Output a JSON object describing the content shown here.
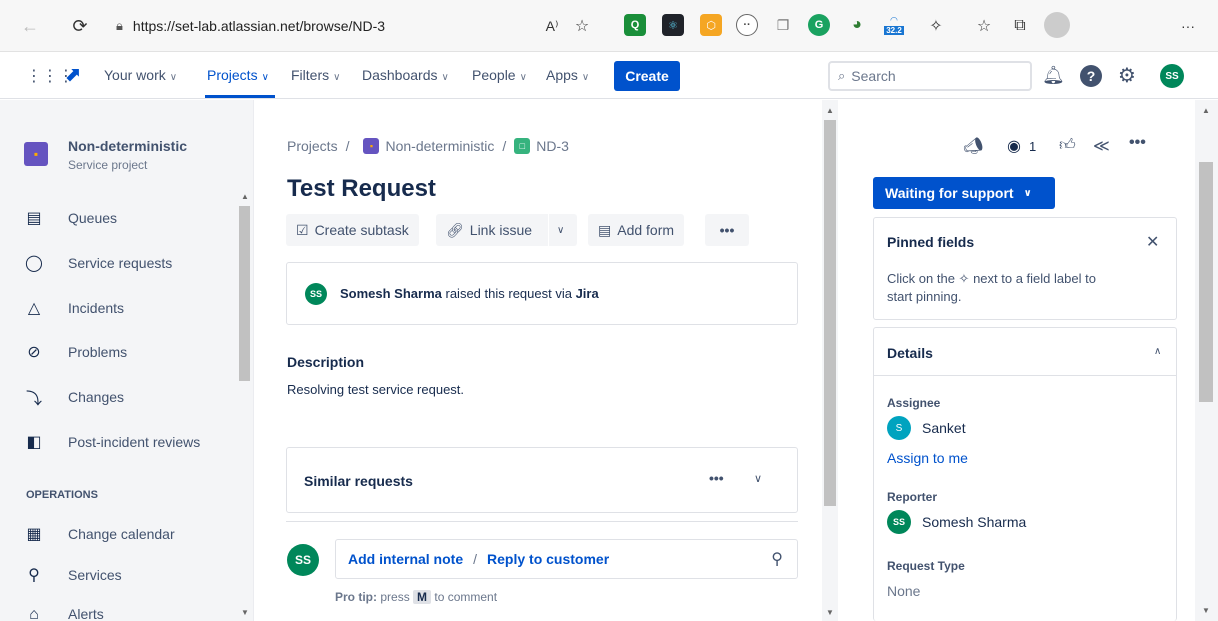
{
  "browser": {
    "url": "https://set-lab.atlassian.net/browse/ND-3",
    "badge": "32.2",
    "more": "···"
  },
  "nav": {
    "items": [
      {
        "label": "Your work",
        "active": false
      },
      {
        "label": "Projects",
        "active": true
      },
      {
        "label": "Filters",
        "active": false
      },
      {
        "label": "Dashboards",
        "active": false
      },
      {
        "label": "People",
        "active": false
      },
      {
        "label": "Apps",
        "active": false
      }
    ],
    "create_label": "Create",
    "search_placeholder": "Search",
    "user_initials": "SS"
  },
  "sidebar": {
    "project_name": "Non-deterministic",
    "project_type": "Service project",
    "items": [
      {
        "label": "Queues",
        "icon": "queues-icon"
      },
      {
        "label": "Service requests",
        "icon": "service-requests-icon"
      },
      {
        "label": "Incidents",
        "icon": "incidents-icon"
      },
      {
        "label": "Problems",
        "icon": "problems-icon"
      },
      {
        "label": "Changes",
        "icon": "changes-icon"
      },
      {
        "label": "Post-incident reviews",
        "icon": "post-incident-reviews-icon"
      }
    ],
    "section_title": "OPERATIONS",
    "ops_items": [
      {
        "label": "Change calendar",
        "icon": "calendar-icon"
      },
      {
        "label": "Services",
        "icon": "services-icon"
      },
      {
        "label": "Alerts",
        "icon": "alerts-icon"
      }
    ]
  },
  "issue": {
    "breadcrumb": {
      "root": "Projects",
      "project": "Non-deterministic",
      "key": "ND-3",
      "sep": "/"
    },
    "title": "Test Request",
    "toolbar": {
      "create_subtask": "Create subtask",
      "link_issue": "Link issue",
      "add_form": "Add form",
      "more": "•••"
    },
    "raised_by": {
      "initials": "SS",
      "name": "Somesh Sharma",
      "text": "raised this request via",
      "via": "Jira"
    },
    "description_label": "Description",
    "description": "Resolving test service request.",
    "similar_requests": "Similar requests",
    "comment": {
      "initials": "SS",
      "add_internal_note": "Add internal note",
      "sep": "/",
      "reply_to_customer": "Reply to customer"
    },
    "protip": {
      "prefix": "Pro tip:",
      "text1": "press",
      "key": "M",
      "text2": "to comment"
    }
  },
  "right_panel": {
    "watch_count": "1",
    "status": "Waiting for support",
    "pinned": {
      "title": "Pinned fields",
      "text1": "Click on the",
      "text2": "next to a field label to",
      "text3": "start pinning."
    },
    "details": {
      "title": "Details",
      "assignee_label": "Assignee",
      "assignee_initials": "S",
      "assignee_name": "Sanket",
      "assign_to_me": "Assign to me",
      "reporter_label": "Reporter",
      "reporter_initials": "SS",
      "reporter_name": "Somesh Sharma",
      "request_type_label": "Request Type",
      "request_type_value": "None"
    }
  },
  "colors": {
    "primary": "#0052cc",
    "avatar_green": "#00875a",
    "assignee_teal": "#00a3bf",
    "project_purple": "#6554c0"
  }
}
